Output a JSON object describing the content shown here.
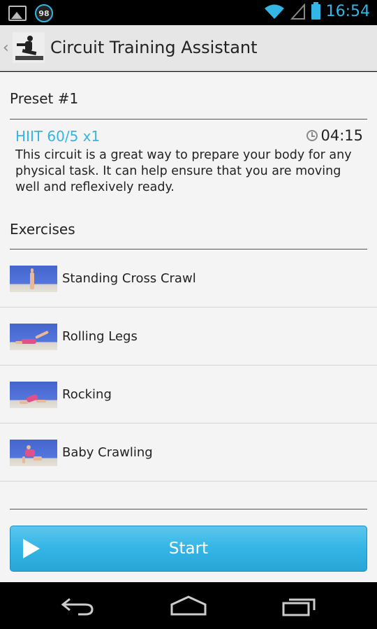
{
  "status_bar": {
    "badge": "98",
    "time": "16:54",
    "accent_color": "#33b5e5",
    "icons": [
      "gallery-icon",
      "notification-badge-icon",
      "wifi-icon",
      "signal-icon",
      "battery-icon"
    ]
  },
  "action_bar": {
    "title": "Circuit Training Assistant",
    "up_icon": "chevron-left-icon",
    "logo_icon": "app-logo-icon"
  },
  "preset": {
    "heading": "Preset #1",
    "workout_name": "HIIT 60/5 x1",
    "duration": "04:15",
    "timer_icon": "alarm-clock-icon",
    "description": "This circuit is a great way to prepare your body for any physical task. It can help ensure that you are moving well and reflexively ready."
  },
  "exercises": {
    "heading": "Exercises",
    "items": [
      {
        "label": "Standing Cross Crawl"
      },
      {
        "label": "Rolling Legs"
      },
      {
        "label": "Rocking"
      },
      {
        "label": "Baby Crawling"
      }
    ]
  },
  "start_button": {
    "label": "Start",
    "icon": "play-icon",
    "color": "#33b5e5"
  },
  "nav_bar": {
    "icons": [
      "back-icon",
      "home-icon",
      "recent-apps-icon"
    ]
  }
}
